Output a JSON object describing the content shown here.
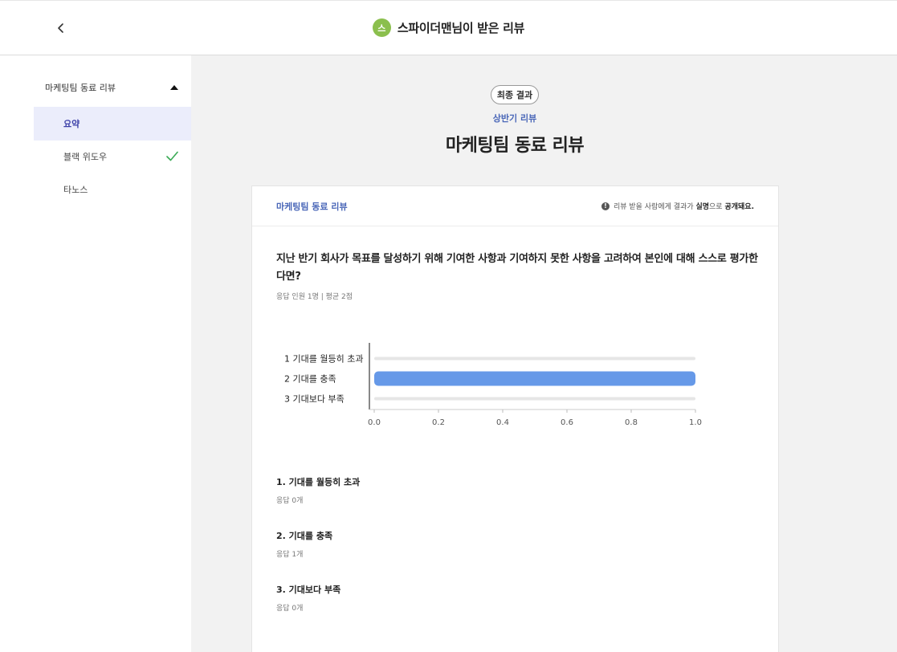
{
  "header": {
    "back_icon": "chevron-left-icon",
    "avatar_initial": "스",
    "avatar_color": "#8bbf4d",
    "title": "스파이더맨님이 받은 리뷰"
  },
  "sidebar": {
    "group_label": "마케팅팀 동료 리뷰",
    "items": [
      {
        "label": "요약",
        "active": true
      },
      {
        "label": "블랙 위도우",
        "completed": true
      },
      {
        "label": "타노스"
      }
    ]
  },
  "main": {
    "badge": "최종 결과",
    "period": "상반기 리뷰",
    "title": "마케팅팀 동료 리뷰"
  },
  "card": {
    "title": "마케팅팀 동료 리뷰",
    "notice_prefix": "리뷰 받을 사람에게 결과가 ",
    "notice_bold1": "실명",
    "notice_mid": "으로 ",
    "notice_bold2": "공개돼요.",
    "question": "지난 반기 회사가 목표를 달성하기 위해 기여한 사항과 기여하지 못한 사항을 고려하여 본인에 대해 스스로 평가한다면?",
    "stats": "응답 인원 1명 | 평균 2점",
    "answers": [
      {
        "title": "1. 기대를 월등히 초과",
        "count": "응답 0개"
      },
      {
        "title": "2. 기대를 충족",
        "count": "응답 1개"
      },
      {
        "title": "3. 기대보다 부족",
        "count": "응답 0개"
      }
    ]
  },
  "chart_data": {
    "type": "bar",
    "orientation": "horizontal",
    "categories": [
      "1  기대를 월등히 초과",
      "2  기대를 충족",
      "3  기대보다 부족"
    ],
    "values": [
      0,
      1,
      0
    ],
    "xlim": [
      0,
      1
    ],
    "xticks": [
      "0.0",
      "0.2",
      "0.4",
      "0.6",
      "0.8",
      "1.0"
    ],
    "bar_color": "#6699e8",
    "track_color": "#e6e6e6"
  },
  "colors": {
    "accent": "#4a67b8",
    "active_bg": "#ebedfb",
    "check": "#3aaa55"
  }
}
